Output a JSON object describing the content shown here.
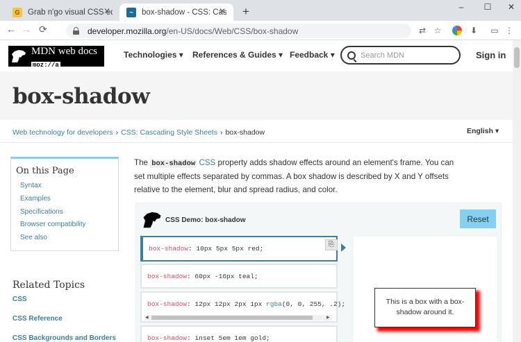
{
  "browser": {
    "tabs": [
      {
        "title": "Grab n'go visual CSS editor",
        "favicon_letter": "G",
        "active": false
      },
      {
        "title": "box-shadow - CSS: Cascading Style Sheets",
        "favicon_letter": "~",
        "active": true
      }
    ],
    "new_tab_label": "+",
    "window_controls": {
      "minimize": "–",
      "maximize": "☐",
      "close": "✕"
    },
    "nav": {
      "back": "←",
      "forward": "→",
      "reload": "⟳"
    },
    "url_host": "developer.mozilla.org",
    "url_path": "/en-US/docs/Web/CSS/box-shadow",
    "extension_icons": [
      "translate-icon",
      "star-icon",
      "extension-icon",
      "download-icon",
      "cast-icon",
      "account-icon",
      "menu-icon"
    ]
  },
  "header": {
    "logo_line1": "MDN web docs",
    "logo_line2": "moz://a",
    "nav": [
      "Technologies ▾",
      "References & Guides ▾",
      "Feedback ▾"
    ],
    "search_placeholder": "Search MDN",
    "signin": "Sign in"
  },
  "page": {
    "title": "box-shadow",
    "breadcrumb": [
      "Web technology for developers",
      "CSS: Cascading Style Sheets",
      "box-shadow"
    ],
    "breadcrumb_sep": "›",
    "language": "English ▾",
    "intro_before_code": "The ",
    "intro_code": "box-shadow",
    "intro_link": "CSS",
    "intro_after": " property adds shadow effects around an element's frame. You can set multiple effects separated by commas. A box shadow is described by X and Y offsets relative to the element, blur and spread radius, and color."
  },
  "sidebar": {
    "on_this_page_title": "On this Page",
    "on_this_page_items": [
      "Syntax",
      "Examples",
      "Specifications",
      "Browser compatibility",
      "See also"
    ],
    "related_title": "Related Topics",
    "related_links": [
      "CSS",
      "CSS Reference",
      "CSS Backgrounds and Borders"
    ]
  },
  "demo": {
    "title": "CSS Demo: box-shadow",
    "reset_label": "Reset",
    "choices": [
      {
        "prop": "box-shadow",
        "value": ": 10px 5px 5px red;",
        "fn": "",
        "rest": "",
        "selected": true
      },
      {
        "prop": "box-shadow",
        "value": ": 60px -16px teal;",
        "fn": "",
        "rest": "",
        "selected": false
      },
      {
        "prop": "box-shadow",
        "value": ": 12px 12px 2px 1px ",
        "fn": "rgba",
        "rest": "(0, 0, 255, .2);",
        "selected": false
      },
      {
        "prop": "box-shadow",
        "value": ": inset 5em 1em gold;",
        "fn": "",
        "rest": "",
        "selected": false
      }
    ],
    "output_text": "This is a box with a box-shadow around it.",
    "shadow_color": "#ff0000"
  },
  "colors": {
    "accent": "#3d7e9a",
    "reset_bg": "#83d0f2",
    "code_prop": "#dd4a68"
  }
}
